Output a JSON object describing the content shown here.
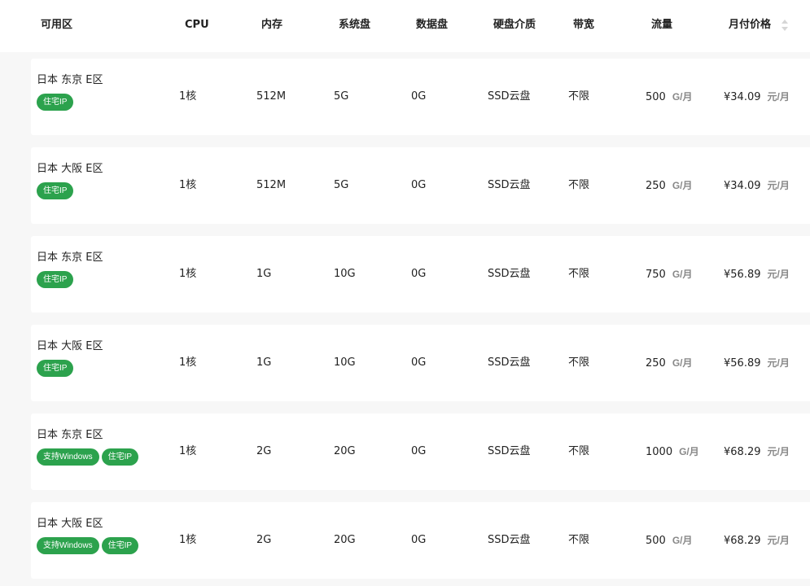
{
  "header": {
    "zone": "可用区",
    "cpu": "CPU",
    "memory": "内存",
    "system_disk": "系统盘",
    "data_disk": "数据盘",
    "disk_medium": "硬盘介质",
    "bandwidth": "带宽",
    "traffic": "流量",
    "monthly_price": "月付价格"
  },
  "units": {
    "traffic": "G/月",
    "price": "元/月"
  },
  "colors": {
    "tag_bg": "#2ca24d",
    "row_bg": "#ffffff",
    "table_bg": "#f7f7f7"
  },
  "rows": [
    {
      "zone": "日本 东京 E区",
      "tags": [
        "住宅IP"
      ],
      "cpu": "1核",
      "memory": "512M",
      "system_disk": "5G",
      "data_disk": "0G",
      "disk_medium": "SSD云盘",
      "bandwidth": "不限",
      "traffic": "500",
      "price": "¥34.09"
    },
    {
      "zone": "日本 大阪 E区",
      "tags": [
        "住宅IP"
      ],
      "cpu": "1核",
      "memory": "512M",
      "system_disk": "5G",
      "data_disk": "0G",
      "disk_medium": "SSD云盘",
      "bandwidth": "不限",
      "traffic": "250",
      "price": "¥34.09"
    },
    {
      "zone": "日本 东京 E区",
      "tags": [
        "住宅IP"
      ],
      "cpu": "1核",
      "memory": "1G",
      "system_disk": "10G",
      "data_disk": "0G",
      "disk_medium": "SSD云盘",
      "bandwidth": "不限",
      "traffic": "750",
      "price": "¥56.89"
    },
    {
      "zone": "日本 大阪 E区",
      "tags": [
        "住宅IP"
      ],
      "cpu": "1核",
      "memory": "1G",
      "system_disk": "10G",
      "data_disk": "0G",
      "disk_medium": "SSD云盘",
      "bandwidth": "不限",
      "traffic": "250",
      "price": "¥56.89"
    },
    {
      "zone": "日本 东京 E区",
      "tags": [
        "支持Windows",
        "住宅IP"
      ],
      "cpu": "1核",
      "memory": "2G",
      "system_disk": "20G",
      "data_disk": "0G",
      "disk_medium": "SSD云盘",
      "bandwidth": "不限",
      "traffic": "1000",
      "price": "¥68.29"
    },
    {
      "zone": "日本 大阪 E区",
      "tags": [
        "支持Windows",
        "住宅IP"
      ],
      "cpu": "1核",
      "memory": "2G",
      "system_disk": "20G",
      "data_disk": "0G",
      "disk_medium": "SSD云盘",
      "bandwidth": "不限",
      "traffic": "500",
      "price": "¥68.29"
    }
  ]
}
